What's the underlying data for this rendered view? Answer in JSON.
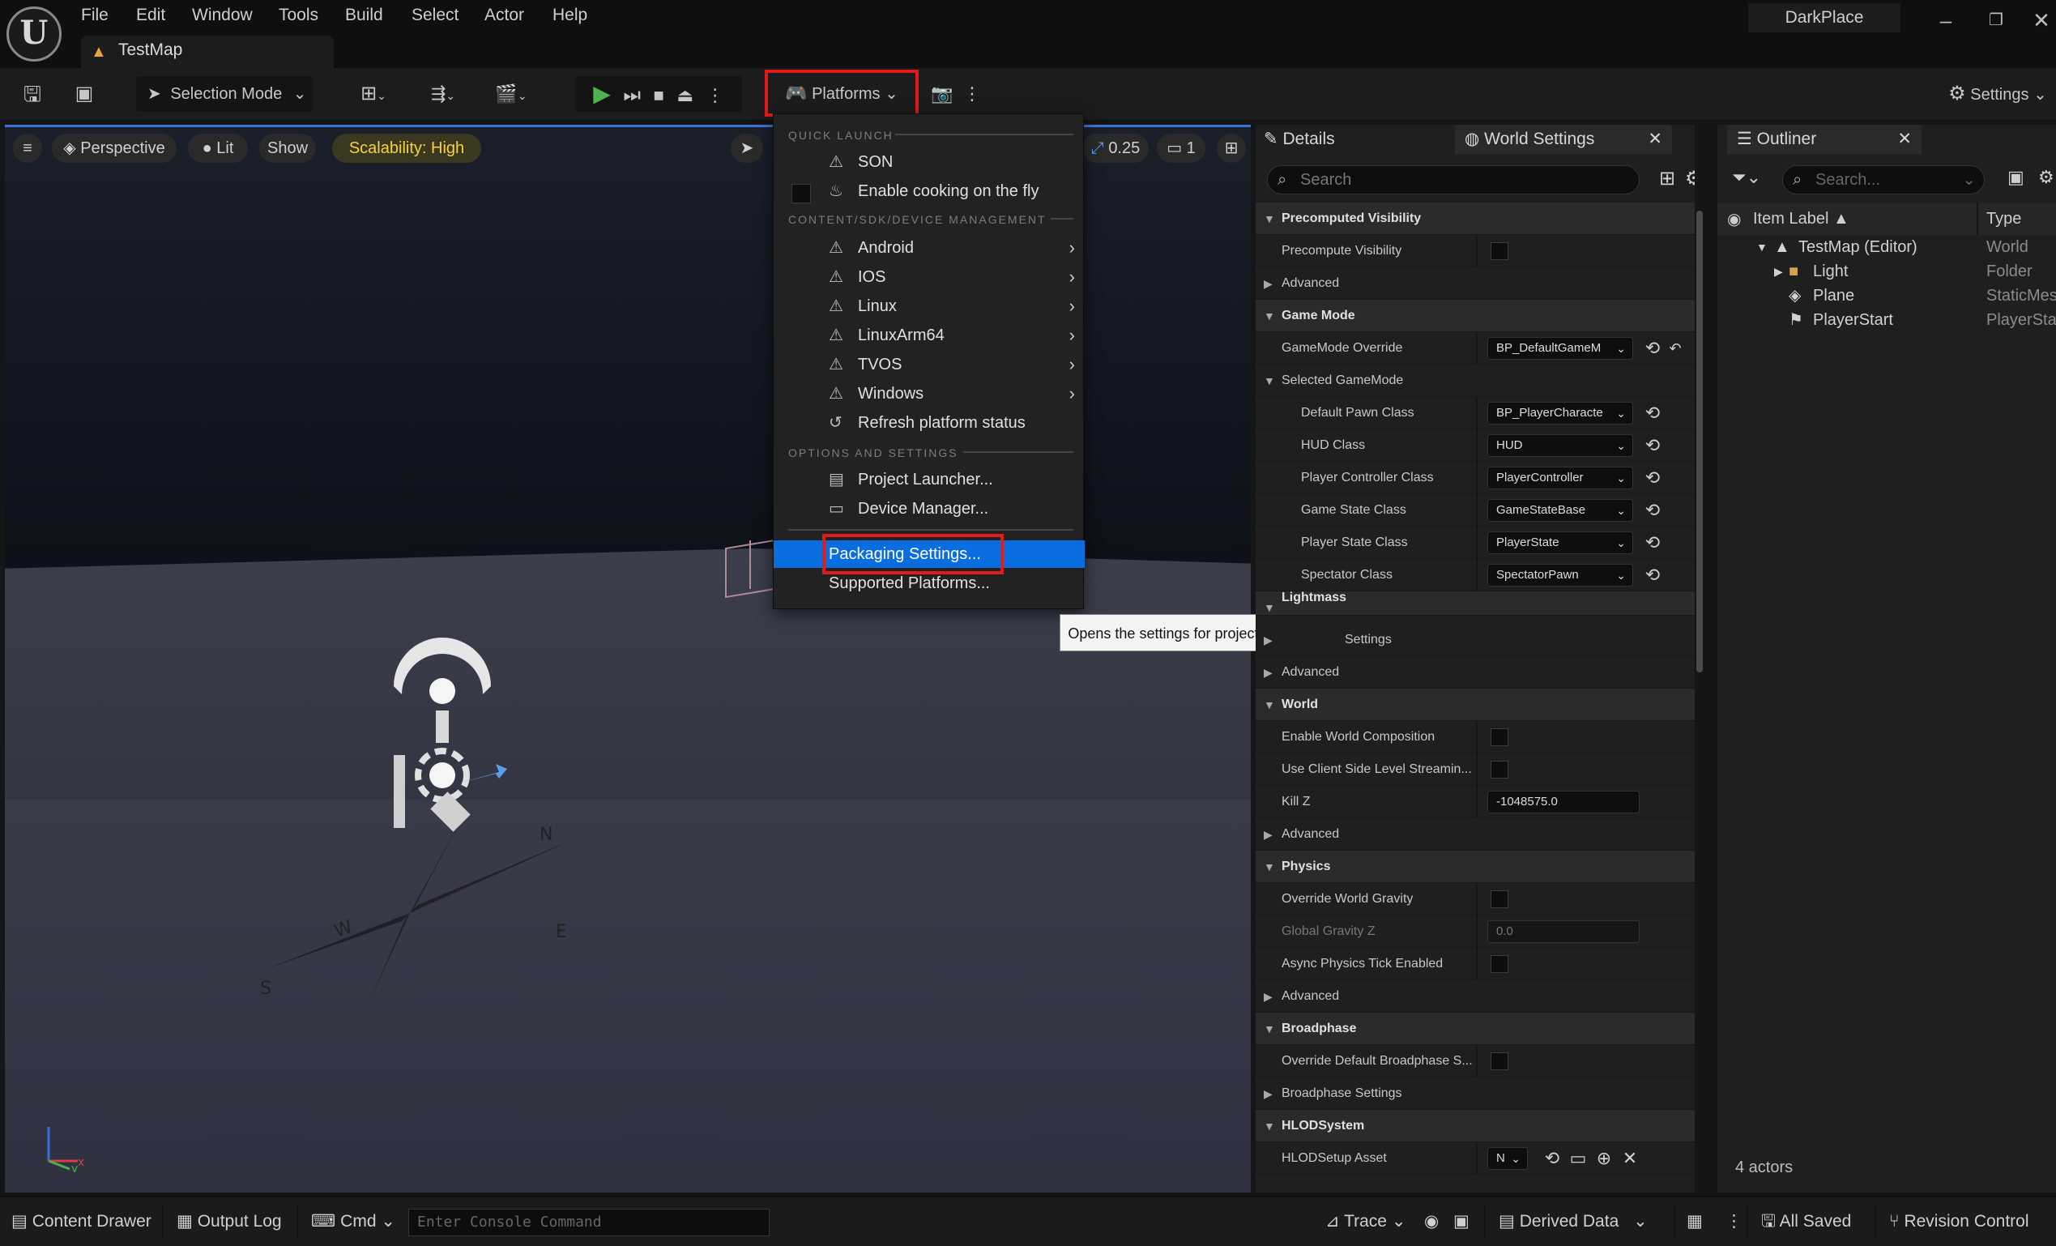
{
  "menu": [
    "File",
    "Edit",
    "Window",
    "Tools",
    "Build",
    "Select",
    "Actor",
    "Help"
  ],
  "project_name": "DarkPlace",
  "document_tab": "TestMap",
  "toolbar": {
    "selection_mode": "Selection Mode",
    "platforms": "Platforms",
    "settings": "Settings"
  },
  "viewport": {
    "perspective": "Perspective",
    "lit": "Lit",
    "show": "Show",
    "scalability": "Scalability: High",
    "grid_value": "0.25",
    "camera_speed": "1"
  },
  "platform_menu": {
    "quick_launch": "QUICK LAUNCH",
    "son": "SON",
    "cooking": "Enable cooking on the fly",
    "content_header": "CONTENT/SDK/DEVICE MANAGEMENT",
    "platforms": [
      "Android",
      "IOS",
      "Linux",
      "LinuxArm64",
      "TVOS",
      "Windows"
    ],
    "refresh": "Refresh platform status",
    "options_header": "OPTIONS AND SETTINGS",
    "project_launcher": "Project Launcher...",
    "device_manager": "Device Manager...",
    "packaging_settings": "Packaging Settings...",
    "supported_platforms": "Supported Platforms..."
  },
  "tooltip": "Opens the settings for project packaging.",
  "details": {
    "tab_details": "Details",
    "tab_world": "World Settings",
    "search_placeholder": "Search",
    "rows": {
      "precomputed_visibility": "Precomputed Visibility",
      "precompute_visibility": "Precompute Visibility",
      "advanced": "Advanced",
      "game_mode": "Game Mode",
      "gamemode_override": "GameMode Override",
      "gamemode_override_value": "BP_DefaultGameM",
      "selected_gamemode": "Selected GameMode",
      "default_pawn": "Default Pawn Class",
      "default_pawn_value": "BP_PlayerCharacte",
      "hud_class": "HUD Class",
      "hud_value": "HUD",
      "player_controller": "Player Controller Class",
      "player_controller_value": "PlayerController",
      "game_state": "Game State Class",
      "game_state_value": "GameStateBase",
      "player_state": "Player State Class",
      "player_state_value": "PlayerState",
      "spectator": "Spectator Class",
      "spectator_value": "SpectatorPawn",
      "lightmass": "Lightmass",
      "lightmass_settings": "Settings",
      "world": "World",
      "enable_world_composition": "Enable World Composition",
      "client_side_streaming": "Use Client Side Level Streamin...",
      "kill_z": "Kill Z",
      "kill_z_value": "-1048575.0",
      "physics": "Physics",
      "override_gravity": "Override World Gravity",
      "global_gravity": "Global Gravity Z",
      "global_gravity_value": "0.0",
      "async_physics": "Async Physics Tick Enabled",
      "broadphase": "Broadphase",
      "override_broadphase": "Override Default Broadphase S...",
      "broadphase_settings": "Broadphase Settings",
      "hlod_system": "HLODSystem",
      "hlod_setup": "HLODSetup Asset",
      "hlod_value": "N"
    }
  },
  "outliner": {
    "title": "Outliner",
    "search_placeholder": "Search...",
    "col_label": "Item Label",
    "col_type": "Type",
    "items": [
      {
        "label": "TestMap (Editor)",
        "type": "World"
      },
      {
        "label": "Light",
        "type": "Folder"
      },
      {
        "label": "Plane",
        "type": "StaticMes"
      },
      {
        "label": "PlayerStart",
        "type": "PlayerSta"
      }
    ],
    "count": "4 actors"
  },
  "statusbar": {
    "content_drawer": "Content Drawer",
    "output_log": "Output Log",
    "cmd": "Cmd",
    "console_placeholder": "Enter Console Command",
    "trace": "Trace",
    "derived_data": "Derived Data",
    "all_saved": "All Saved",
    "revision_control": "Revision Control"
  },
  "colors": {
    "accent": "#0b6ee0",
    "highlight": "#e01b1b",
    "scalability": "#f5d33a",
    "play": "#4fb44f"
  }
}
